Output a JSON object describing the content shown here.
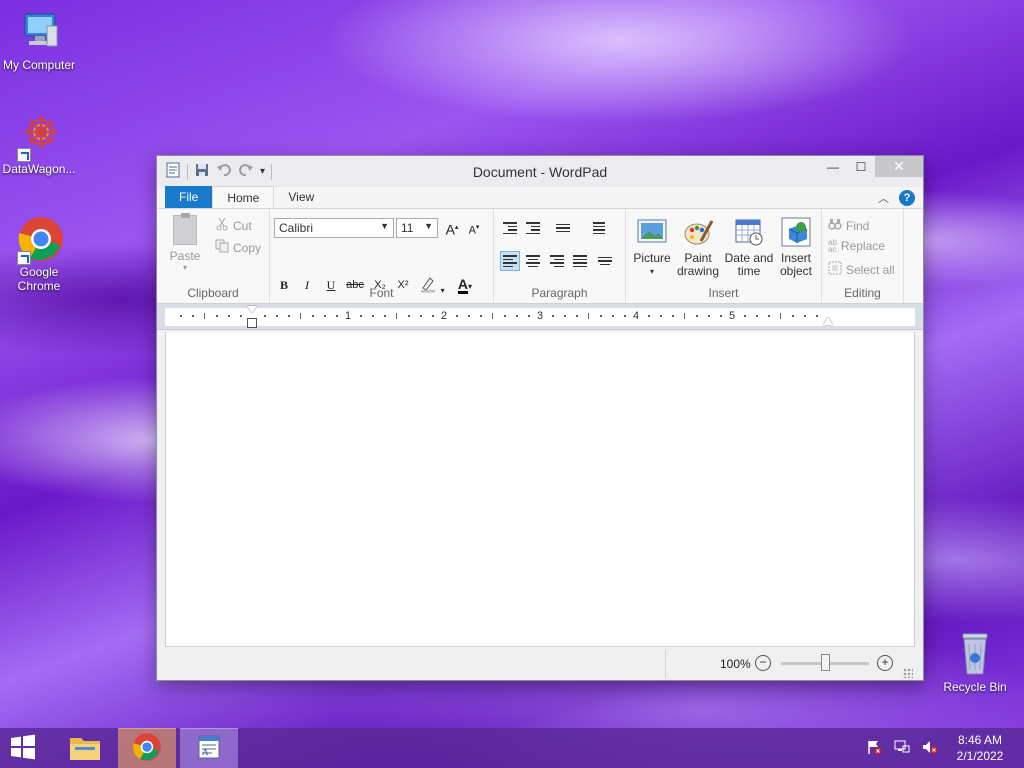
{
  "desktop": {
    "icons": [
      {
        "label": "My Computer"
      },
      {
        "label": "DataWagon..."
      },
      {
        "label": "Google Chrome"
      },
      {
        "label": "Recycle Bin"
      }
    ]
  },
  "window": {
    "title": "Document - WordPad",
    "controls": {
      "minimize": "—",
      "maximize": "☐",
      "close": "✕"
    },
    "tabs": {
      "file": "File",
      "home": "Home",
      "view": "View"
    },
    "help_symbol": "?",
    "ribbon": {
      "clipboard": {
        "label": "Clipboard",
        "paste": "Paste",
        "cut": "Cut",
        "copy": "Copy"
      },
      "font": {
        "label": "Font",
        "family": "Calibri",
        "size": "11",
        "grow": "A",
        "shrink": "A",
        "bold": "B",
        "italic": "I",
        "underline": "U",
        "strike": "abc",
        "subscript": "X₂",
        "superscript": "X²",
        "color_letter": "A",
        "highlight_color": "#c0c0c0",
        "font_color": "#000000"
      },
      "paragraph": {
        "label": "Paragraph"
      },
      "insert": {
        "label": "Insert",
        "picture": "Picture",
        "paint_l1": "Paint",
        "paint_l2": "drawing",
        "date_l1": "Date and",
        "date_l2": "time",
        "object_l1": "Insert",
        "object_l2": "object"
      },
      "editing": {
        "label": "Editing",
        "find": "Find",
        "replace": "Replace",
        "select_all": "Select all"
      }
    },
    "ruler": {
      "numbers": [
        "1",
        "2",
        "3",
        "4",
        "5"
      ]
    },
    "status": {
      "zoom": "100%",
      "zoom_out": "−",
      "zoom_in": "+",
      "zoom_level": 1.0
    }
  },
  "taskbar": {
    "time": "8:46 AM",
    "date": "2/1/2022"
  }
}
